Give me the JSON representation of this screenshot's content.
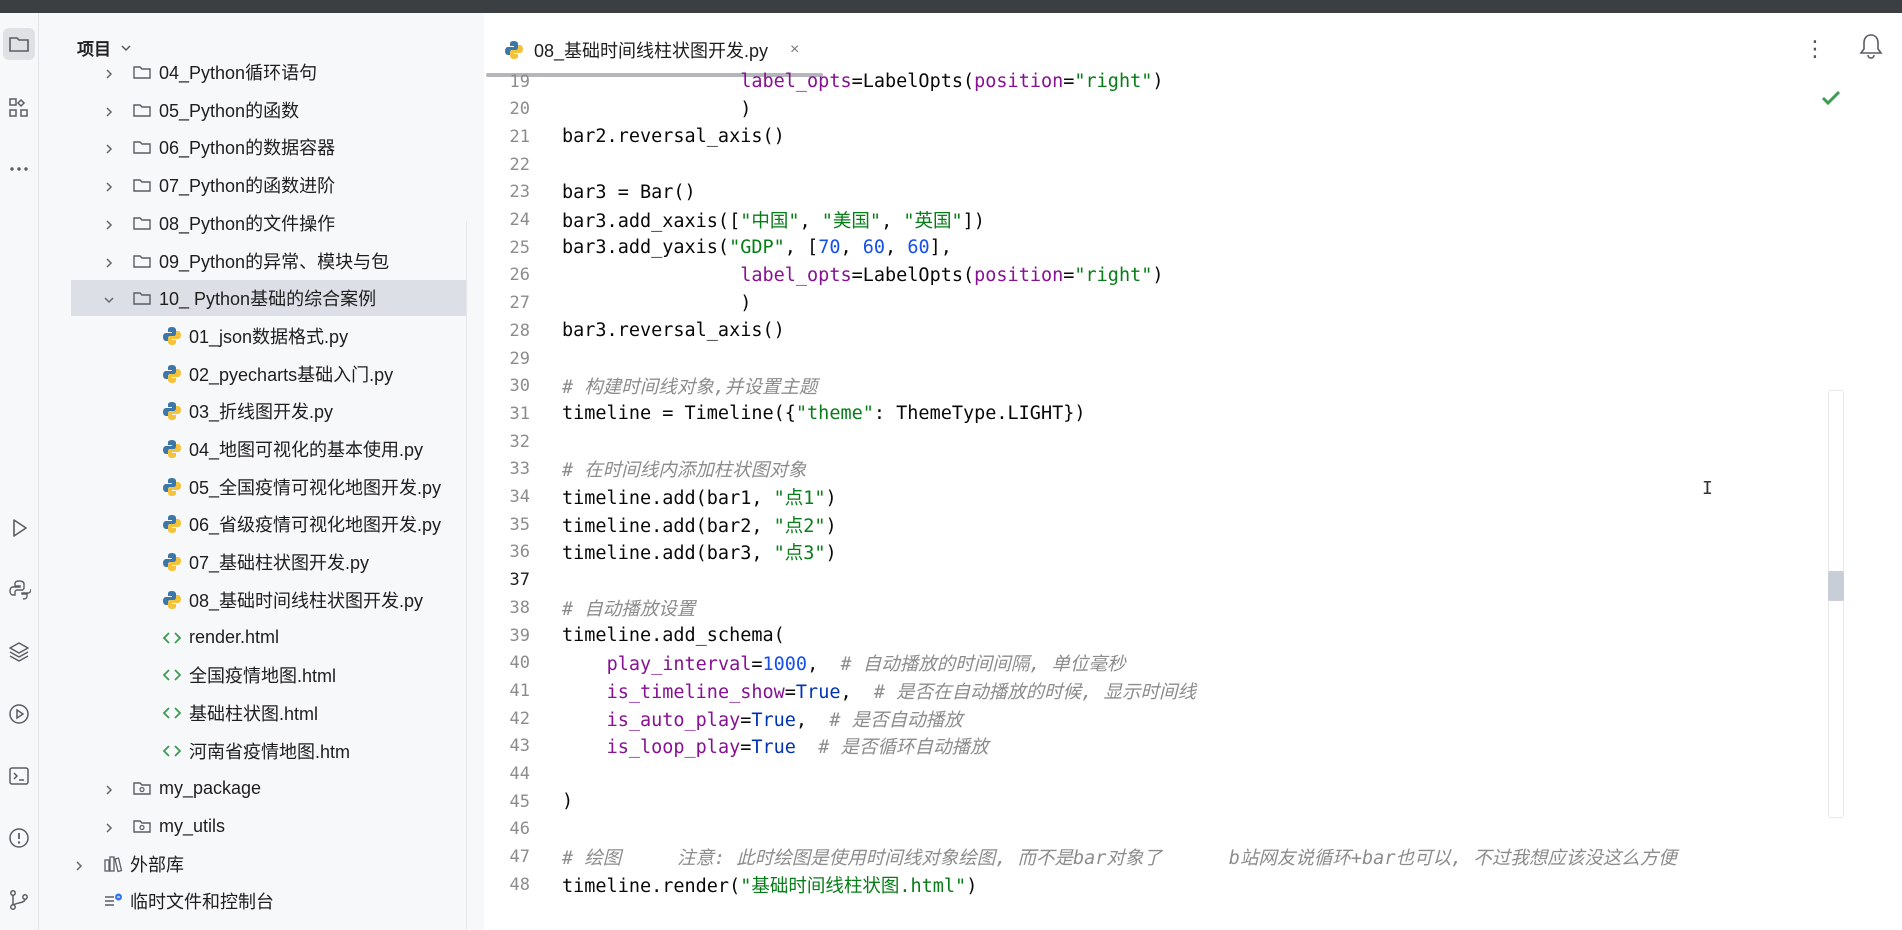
{
  "project_panel": {
    "title": "项目",
    "items": [
      {
        "label": "04_Python循环语句",
        "type": "folder",
        "depth": 1,
        "expanded": false
      },
      {
        "label": "05_Python的函数",
        "type": "folder",
        "depth": 1,
        "expanded": false
      },
      {
        "label": "06_Python的数据容器",
        "type": "folder",
        "depth": 1,
        "expanded": false
      },
      {
        "label": "07_Python的函数进阶",
        "type": "folder",
        "depth": 1,
        "expanded": false
      },
      {
        "label": "08_Python的文件操作",
        "type": "folder",
        "depth": 1,
        "expanded": false
      },
      {
        "label": "09_Python的异常、模块与包",
        "type": "folder",
        "depth": 1,
        "expanded": false
      },
      {
        "label": "10_ Python基础的综合案例",
        "type": "folder",
        "depth": 1,
        "expanded": true,
        "selected": true
      },
      {
        "label": "01_json数据格式.py",
        "type": "python",
        "depth": 2
      },
      {
        "label": "02_pyecharts基础入门.py",
        "type": "python",
        "depth": 2
      },
      {
        "label": "03_折线图开发.py",
        "type": "python",
        "depth": 2
      },
      {
        "label": "04_地图可视化的基本使用.py",
        "type": "python",
        "depth": 2
      },
      {
        "label": "05_全国疫情可视化地图开发.py",
        "type": "python",
        "depth": 2
      },
      {
        "label": "06_省级疫情可视化地图开发.py",
        "type": "python",
        "depth": 2
      },
      {
        "label": "07_基础柱状图开发.py",
        "type": "python",
        "depth": 2
      },
      {
        "label": "08_基础时间线柱状图开发.py",
        "type": "python",
        "depth": 2
      },
      {
        "label": "render.html",
        "type": "html",
        "depth": 2
      },
      {
        "label": "全国疫情地图.html",
        "type": "html",
        "depth": 2
      },
      {
        "label": "基础柱状图.html",
        "type": "html",
        "depth": 2
      },
      {
        "label": "河南省疫情地图.htm",
        "type": "html",
        "depth": 2
      },
      {
        "label": "my_package",
        "type": "package",
        "depth": 1,
        "expanded": false
      },
      {
        "label": "my_utils",
        "type": "package",
        "depth": 1,
        "expanded": false
      },
      {
        "label": "外部库",
        "type": "library",
        "depth": 0,
        "expanded": false
      },
      {
        "label": "临时文件和控制台",
        "type": "scratch",
        "depth": 0
      }
    ]
  },
  "editor": {
    "tab": {
      "label": "08_基础时间线柱状图开发.py",
      "close": "×"
    },
    "more_menu": "⋮",
    "current_line": 37,
    "lines": [
      {
        "n": 19,
        "tokens": [
          [
            "",
            "                "
          ],
          [
            "kw",
            "label_opts"
          ],
          [
            "",
            "=LabelOpts("
          ],
          [
            "kw",
            "position"
          ],
          [
            "",
            "="
          ],
          [
            "str",
            "\"right\""
          ],
          [
            "",
            ")"
          ]
        ]
      },
      {
        "n": 20,
        "tokens": [
          [
            "",
            "                )"
          ]
        ]
      },
      {
        "n": 21,
        "tokens": [
          [
            "",
            "bar2.reversal_axis()"
          ]
        ]
      },
      {
        "n": 22,
        "tokens": []
      },
      {
        "n": 23,
        "tokens": [
          [
            "",
            "bar3 = Bar()"
          ]
        ]
      },
      {
        "n": 24,
        "tokens": [
          [
            "",
            "bar3.add_xaxis(["
          ],
          [
            "str",
            "\"中国\""
          ],
          [
            "",
            ", "
          ],
          [
            "str",
            "\"美国\""
          ],
          [
            "",
            ", "
          ],
          [
            "str",
            "\"英国\""
          ],
          [
            "",
            "])"
          ]
        ]
      },
      {
        "n": 25,
        "tokens": [
          [
            "",
            "bar3.add_yaxis("
          ],
          [
            "str",
            "\"GDP\""
          ],
          [
            "",
            ", ["
          ],
          [
            "num",
            "70"
          ],
          [
            "",
            ", "
          ],
          [
            "num",
            "60"
          ],
          [
            "",
            ", "
          ],
          [
            "num",
            "60"
          ],
          [
            "",
            "],"
          ]
        ]
      },
      {
        "n": 26,
        "tokens": [
          [
            "",
            "                "
          ],
          [
            "kw",
            "label_opts"
          ],
          [
            "",
            "=LabelOpts("
          ],
          [
            "kw",
            "position"
          ],
          [
            "",
            "="
          ],
          [
            "str",
            "\"right\""
          ],
          [
            "",
            ")"
          ]
        ]
      },
      {
        "n": 27,
        "tokens": [
          [
            "",
            "                )"
          ]
        ]
      },
      {
        "n": 28,
        "tokens": [
          [
            "",
            "bar3.reversal_axis()"
          ]
        ]
      },
      {
        "n": 29,
        "tokens": []
      },
      {
        "n": 30,
        "tokens": [
          [
            "cm",
            "# 构建时间线对象,并设置主题"
          ]
        ]
      },
      {
        "n": 31,
        "tokens": [
          [
            "",
            "timeline = Timeline({"
          ],
          [
            "str",
            "\"theme\""
          ],
          [
            "",
            ": ThemeType.LIGHT})"
          ]
        ]
      },
      {
        "n": 32,
        "tokens": []
      },
      {
        "n": 33,
        "tokens": [
          [
            "cm",
            "# 在时间线内添加柱状图对象"
          ]
        ]
      },
      {
        "n": 34,
        "tokens": [
          [
            "",
            "timeline.add(bar1, "
          ],
          [
            "str",
            "\"点1\""
          ],
          [
            "",
            ")"
          ]
        ]
      },
      {
        "n": 35,
        "tokens": [
          [
            "",
            "timeline.add(bar2, "
          ],
          [
            "str",
            "\"点2\""
          ],
          [
            "",
            ")"
          ]
        ]
      },
      {
        "n": 36,
        "tokens": [
          [
            "",
            "timeline.add(bar3, "
          ],
          [
            "str",
            "\"点3\""
          ],
          [
            "",
            ")"
          ]
        ]
      },
      {
        "n": 37,
        "tokens": []
      },
      {
        "n": 38,
        "tokens": [
          [
            "cm",
            "# 自动播放设置"
          ]
        ]
      },
      {
        "n": 39,
        "tokens": [
          [
            "",
            "timeline.add_schema("
          ]
        ]
      },
      {
        "n": 40,
        "tokens": [
          [
            "",
            "    "
          ],
          [
            "kw",
            "play_interval"
          ],
          [
            "",
            "="
          ],
          [
            "num",
            "1000"
          ],
          [
            "",
            ",  "
          ],
          [
            "cm",
            "# 自动播放的时间间隔, 单位毫秒"
          ]
        ]
      },
      {
        "n": 41,
        "tokens": [
          [
            "",
            "    "
          ],
          [
            "kw",
            "is_timeline_show"
          ],
          [
            "",
            "="
          ],
          [
            "bi",
            "True"
          ],
          [
            "",
            ",  "
          ],
          [
            "cm",
            "# 是否在自动播放的时候, 显示时间线"
          ]
        ]
      },
      {
        "n": 42,
        "tokens": [
          [
            "",
            "    "
          ],
          [
            "kw",
            "is_auto_play"
          ],
          [
            "",
            "="
          ],
          [
            "bi",
            "True"
          ],
          [
            "",
            ",  "
          ],
          [
            "cm",
            "# 是否自动播放"
          ]
        ]
      },
      {
        "n": 43,
        "tokens": [
          [
            "",
            "    "
          ],
          [
            "kw",
            "is_loop_play"
          ],
          [
            "",
            "="
          ],
          [
            "bi",
            "True"
          ],
          [
            "",
            "  "
          ],
          [
            "cm",
            "# 是否循环自动播放"
          ]
        ]
      },
      {
        "n": 44,
        "tokens": []
      },
      {
        "n": 45,
        "tokens": [
          [
            "",
            ")"
          ]
        ]
      },
      {
        "n": 46,
        "tokens": []
      },
      {
        "n": 47,
        "tokens": [
          [
            "cm",
            "# 绘图     注意: 此时绘图是使用时间线对象绘图, 而不是bar对象了      b站网友说循环+bar也可以, 不过我想应该没这么方便"
          ]
        ]
      },
      {
        "n": 48,
        "tokens": [
          [
            "",
            "timeline.render("
          ],
          [
            "str",
            "\"基础时间线柱状图.html\""
          ],
          [
            "",
            ")"
          ]
        ]
      }
    ]
  },
  "colors": {
    "keyword_arg": "#871094",
    "string": "#067d17",
    "number": "#1750eb",
    "comment": "#8c8c8c",
    "builtin": "#0033b3",
    "inspection_ok": "#3d9b52"
  },
  "activity_bar": [
    "project-icon",
    "structure-icon",
    "more-icon",
    "run-icon",
    "python-console-icon",
    "layers-icon",
    "services-icon",
    "terminal-icon",
    "problems-icon",
    "git-icon"
  ]
}
